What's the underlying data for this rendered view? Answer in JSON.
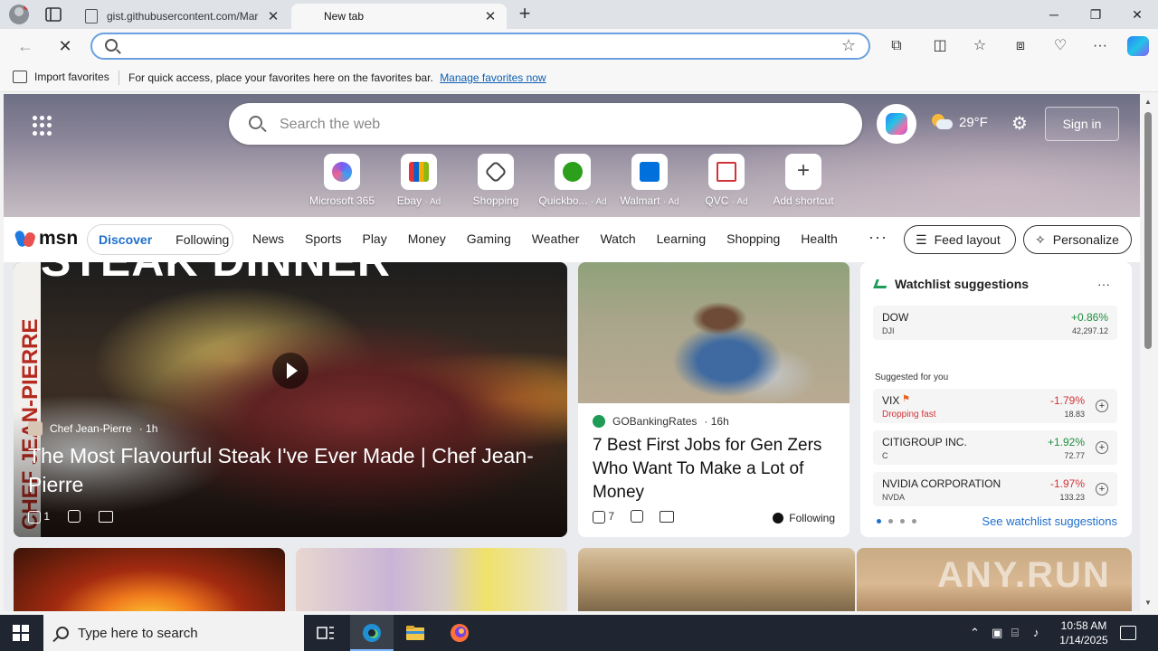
{
  "browser": {
    "tabs": [
      {
        "title": "gist.githubusercontent.com/Mar",
        "active": false
      },
      {
        "title": "New tab",
        "active": true
      }
    ],
    "address": {
      "value": "",
      "placeholder": ""
    },
    "favorites_bar": {
      "import_label": "Import favorites",
      "message": "For quick access, place your favorites here on the favorites bar.",
      "link": "Manage favorites now"
    }
  },
  "hero": {
    "search_placeholder": "Search the web",
    "weather": "29°F",
    "sign_in": "Sign in",
    "shortcuts": [
      {
        "label": "Microsoft 365",
        "ad": "",
        "color": "#6b4fd8"
      },
      {
        "label": "Ebay",
        "ad": "· Ad",
        "color": "#e53238"
      },
      {
        "label": "Shopping",
        "ad": "",
        "color": "#444444"
      },
      {
        "label": "Quickbo...",
        "ad": "· Ad",
        "color": "#2ca01c"
      },
      {
        "label": "Walmart",
        "ad": "· Ad",
        "color": "#0071dc"
      },
      {
        "label": "QVC",
        "ad": "· Ad",
        "color": "#d13438"
      },
      {
        "label": "Add shortcut",
        "ad": "",
        "color": "#ffffff"
      }
    ]
  },
  "nav": {
    "logo": "msn",
    "discover": "Discover",
    "following": "Following",
    "categories": [
      "News",
      "Sports",
      "Play",
      "Money",
      "Gaming",
      "Weather",
      "Watch",
      "Learning",
      "Shopping",
      "Health"
    ],
    "more": "···",
    "feed_layout": "Feed layout",
    "personalize": "Personalize"
  },
  "feature": {
    "banner": "STEAK DINNER",
    "vertical_text": "CHEF JEAN-PIERRE",
    "source": "Chef Jean-Pierre",
    "age": "· 1h",
    "headline": "The Most Flavourful Steak I've Ever Made | Chef Jean-Pierre",
    "likes": "1"
  },
  "story": {
    "source": "GOBankingRates",
    "age": "· 16h",
    "headline": "7 Best First Jobs for Gen Zers Who Want To Make a Lot of Money",
    "likes": "7",
    "following": "Following"
  },
  "watchlist": {
    "title": "Watchlist suggestions",
    "top": {
      "name": "DOW",
      "symbol": "DJI",
      "change": "+0.86%",
      "price": "42,297.12"
    },
    "suggested_label": "Suggested for you",
    "items": [
      {
        "name": "VIX",
        "symbol": "",
        "alert": "Dropping fast",
        "change": "-1.79%",
        "price": "18.83",
        "dir": "down"
      },
      {
        "name": "CITIGROUP INC.",
        "symbol": "C",
        "alert": "",
        "change": "+1.92%",
        "price": "72.77",
        "dir": "up"
      },
      {
        "name": "NVIDIA CORPORATION",
        "symbol": "NVDA",
        "alert": "",
        "change": "-1.97%",
        "price": "133.23",
        "dir": "down"
      }
    ],
    "see_more": "See watchlist suggestions"
  },
  "watermark": "ANY.RUN",
  "taskbar": {
    "search_placeholder": "Type here to search",
    "time": "10:58 AM",
    "date": "1/14/2025"
  }
}
